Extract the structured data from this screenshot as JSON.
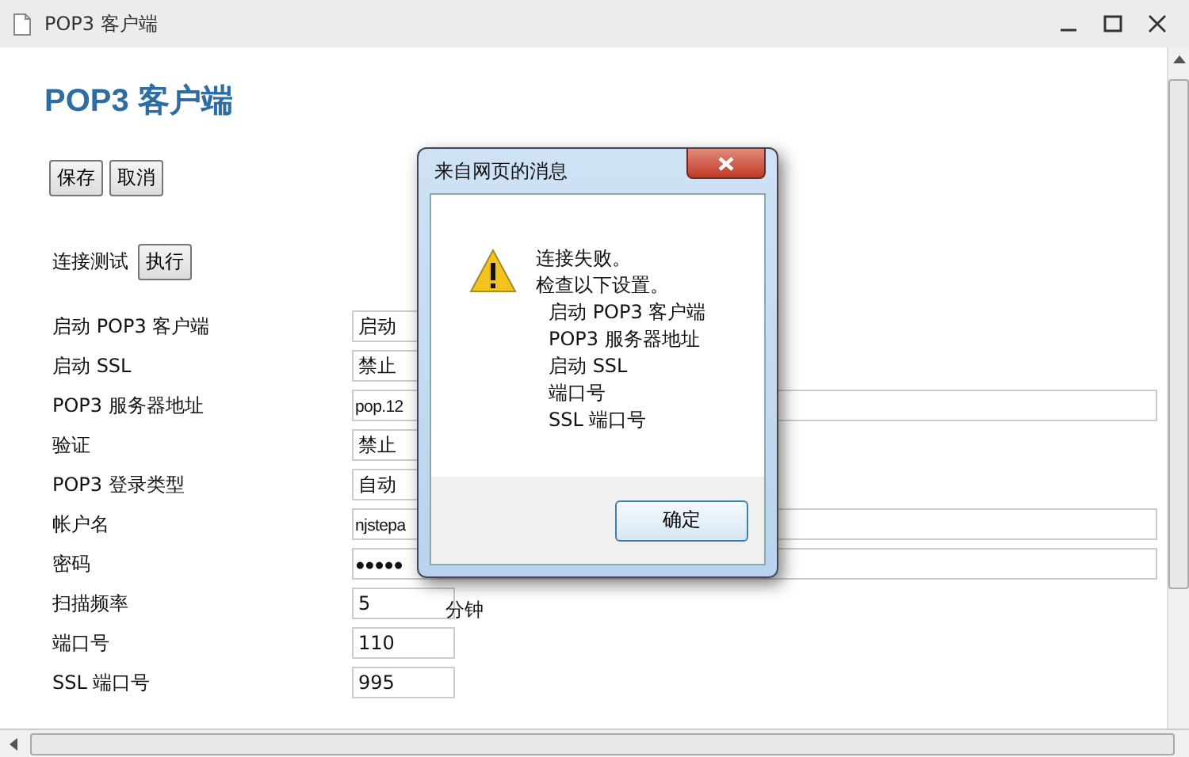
{
  "window": {
    "title": "POP3 客户端"
  },
  "heading": "POP3 客户端",
  "buttons": [
    "保存",
    "取消"
  ],
  "connection_test": {
    "label": "连接测试",
    "button": "执行"
  },
  "settings": [
    {
      "kind": "select",
      "label": "启动 POP3 客户端",
      "value": "启动"
    },
    {
      "kind": "select",
      "label": "启动 SSL",
      "value": "禁止"
    },
    {
      "kind": "text",
      "label": "POP3 服务器地址",
      "value": "pop.12"
    },
    {
      "kind": "select",
      "label": "验证",
      "value": "禁止"
    },
    {
      "kind": "select",
      "label": "POP3 登录类型",
      "value": "自动"
    },
    {
      "kind": "text",
      "label": "帐户名",
      "value": "njstepa"
    },
    {
      "kind": "text",
      "label": "密码",
      "value": "●●●●●"
    },
    {
      "kind": "number",
      "label": "扫描频率",
      "value": "5",
      "unit": "分钟"
    },
    {
      "kind": "number",
      "label": "端口号",
      "value": "110"
    },
    {
      "kind": "number",
      "label": "SSL 端口号",
      "value": "995"
    }
  ],
  "dialog": {
    "title": "来自网页的消息",
    "message": [
      "连接失败。",
      "检查以下设置。"
    ],
    "items": [
      "启动 POP3 客户端",
      "POP3 服务器地址",
      "启动 SSL",
      "端口号",
      "SSL 端口号"
    ],
    "button": "确定"
  }
}
